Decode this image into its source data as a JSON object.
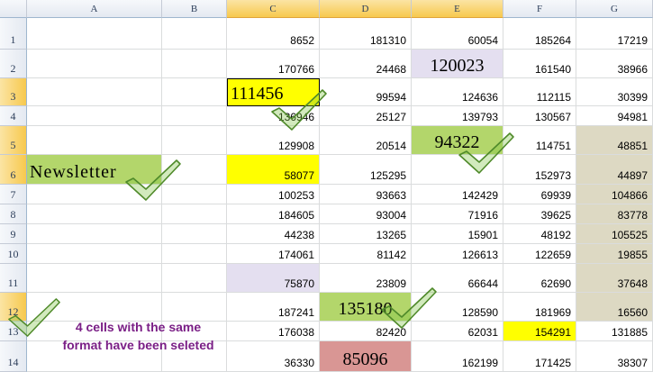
{
  "columns": [
    "A",
    "B",
    "C",
    "D",
    "E",
    "F",
    "G"
  ],
  "selected_columns": [
    "C",
    "D",
    "E"
  ],
  "rows": [
    "1",
    "2",
    "3",
    "4",
    "5",
    "6",
    "7",
    "8",
    "9",
    "10",
    "11",
    "12",
    "13",
    "14"
  ],
  "selected_rows": [
    "3",
    "5",
    "6",
    "12"
  ],
  "cells": {
    "C": [
      "8652",
      "170766",
      "111456",
      "136946",
      "129908",
      "58077",
      "100253",
      "184605",
      "44238",
      "174061",
      "75870",
      "187241",
      "176038",
      "36330"
    ],
    "D": [
      "181310",
      "24468",
      "99594",
      "25127",
      "20514",
      "125295",
      "93663",
      "93004",
      "13265",
      "81142",
      "23809",
      "135180",
      "82420",
      "85096"
    ],
    "E": [
      "60054",
      "120023",
      "124636",
      "139793",
      "94322",
      "",
      "142429",
      "71916",
      "15901",
      "126613",
      "66644",
      "128590",
      "62031",
      "162199"
    ],
    "F": [
      "185264",
      "161540",
      "112115",
      "130567",
      "114751",
      "152973",
      "69939",
      "39625",
      "48192",
      "122659",
      "62690",
      "181969",
      "154291",
      "171425"
    ],
    "G": [
      "17219",
      "38966",
      "30399",
      "94981",
      "48851",
      "44897",
      "104866",
      "83778",
      "105525",
      "19855",
      "37648",
      "16560",
      "131885",
      "38307"
    ]
  },
  "a6_text": "Newsletter",
  "annotation": {
    "line1": "4 cells with the same",
    "line2": "format have been seleted"
  },
  "colors": {
    "yellow": "#ffff00",
    "green": "#b3d66b",
    "lavender": "#e4dff0",
    "tan": "#ddd9c3",
    "rose": "#d99694",
    "selected_header": "#f7c94e",
    "annotation_text": "#7a1f86",
    "checkmark": "#7fc341"
  }
}
